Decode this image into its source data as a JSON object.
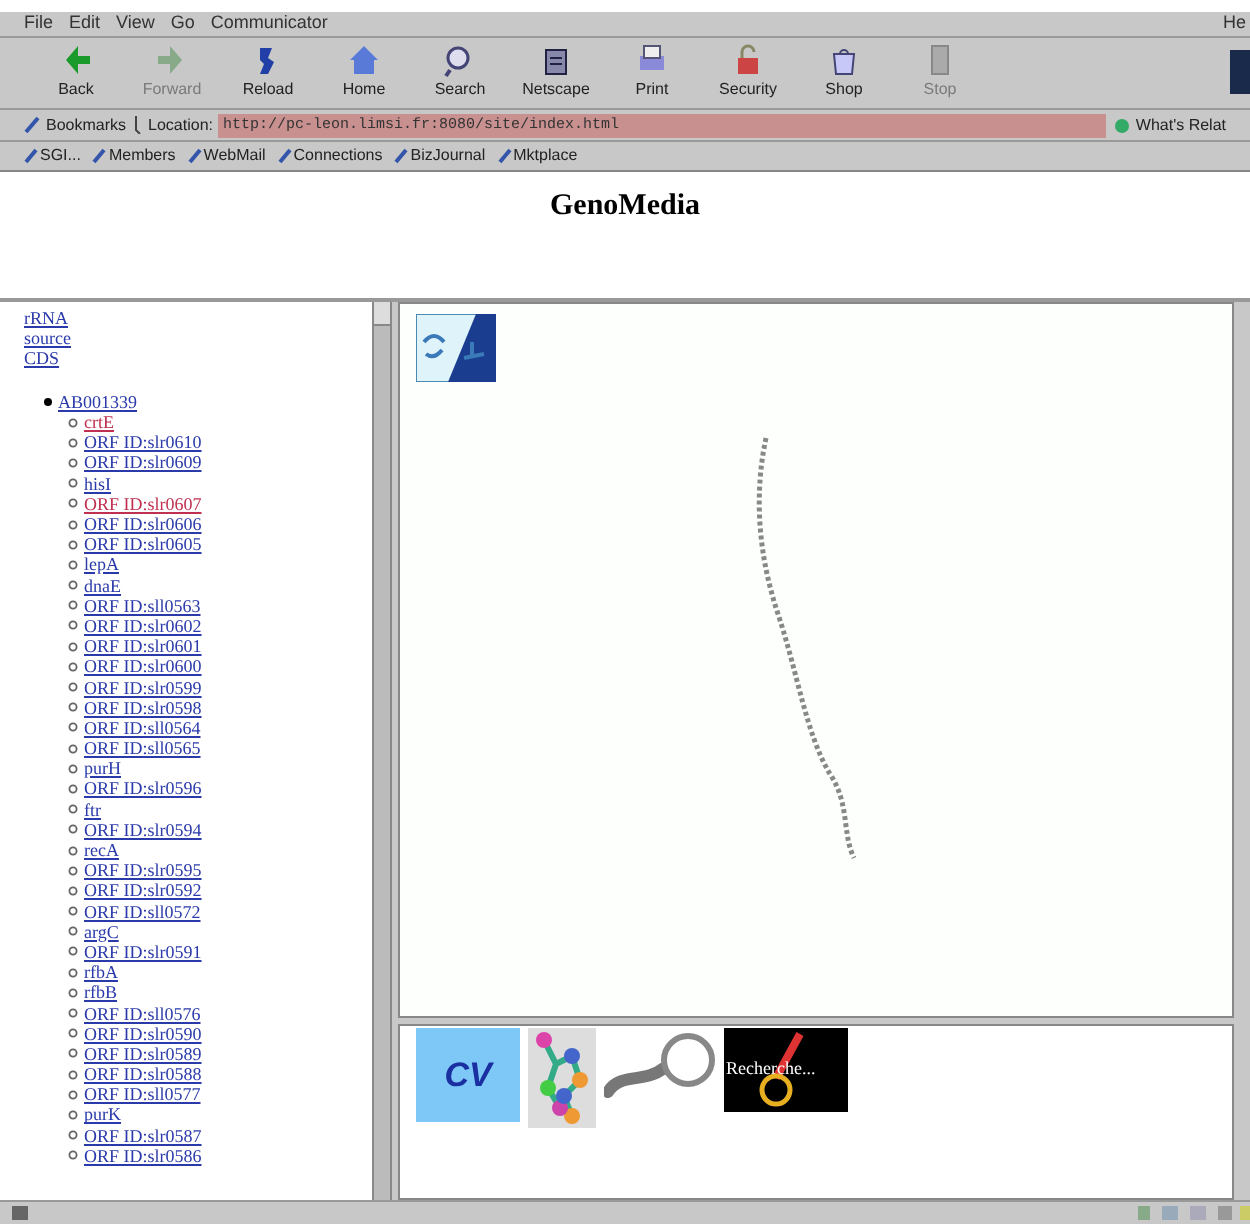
{
  "menu": [
    "File",
    "Edit",
    "View",
    "Go",
    "Communicator"
  ],
  "help_menu": "He",
  "toolbar": [
    {
      "label": "Back",
      "kind": "back",
      "disabled": false
    },
    {
      "label": "Forward",
      "kind": "forward",
      "disabled": true
    },
    {
      "label": "Reload",
      "kind": "reload",
      "disabled": false
    },
    {
      "label": "Home",
      "kind": "home",
      "disabled": false
    },
    {
      "label": "Search",
      "kind": "search",
      "disabled": false
    },
    {
      "label": "Netscape",
      "kind": "netscape",
      "disabled": false
    },
    {
      "label": "Print",
      "kind": "print",
      "disabled": false
    },
    {
      "label": "Security",
      "kind": "security",
      "disabled": false
    },
    {
      "label": "Shop",
      "kind": "shop",
      "disabled": false
    },
    {
      "label": "Stop",
      "kind": "stop",
      "disabled": true
    }
  ],
  "location_bar": {
    "bookmarks": "Bookmarks",
    "label": "Location:",
    "url": "http://pc-leon.limsi.fr:8080/site/index.html",
    "related": "What's Relat"
  },
  "personal_toolbar": [
    "SGI...",
    "Members",
    "WebMail",
    "Connections",
    "BizJournal",
    "Mktplace"
  ],
  "header": {
    "title": "GenoMedia"
  },
  "sidebar": {
    "links": [
      "rRNA",
      "source",
      "CDS"
    ],
    "tree": [
      {
        "label": "AB001339",
        "children": [
          {
            "label": "crtE",
            "visited": true
          },
          {
            "label": "ORF ID:slr0610",
            "visited": false
          },
          {
            "label": "ORF ID:slr0609",
            "visited": false
          },
          {
            "label": "hisI",
            "visited": false
          },
          {
            "label": "ORF ID:slr0607",
            "visited": true
          },
          {
            "label": "ORF ID:slr0606",
            "visited": false
          },
          {
            "label": "ORF ID:slr0605",
            "visited": false
          },
          {
            "label": "lepA",
            "visited": false
          },
          {
            "label": "dnaE",
            "visited": false
          },
          {
            "label": "ORF ID:sll0563",
            "visited": false
          },
          {
            "label": "ORF ID:slr0602",
            "visited": false
          },
          {
            "label": "ORF ID:slr0601",
            "visited": false
          },
          {
            "label": "ORF ID:slr0600",
            "visited": false
          },
          {
            "label": "ORF ID:slr0599",
            "visited": false
          },
          {
            "label": "ORF ID:slr0598",
            "visited": false
          },
          {
            "label": "ORF ID:sll0564",
            "visited": false
          },
          {
            "label": "ORF ID:sll0565",
            "visited": false
          },
          {
            "label": "purH",
            "visited": false
          },
          {
            "label": "ORF ID:slr0596",
            "visited": false
          },
          {
            "label": "ftr",
            "visited": false
          },
          {
            "label": "ORF ID:slr0594",
            "visited": false
          },
          {
            "label": "recA",
            "visited": false
          },
          {
            "label": "ORF ID:slr0595",
            "visited": false
          },
          {
            "label": "ORF ID:slr0592",
            "visited": false
          },
          {
            "label": "ORF ID:sll0572",
            "visited": false
          },
          {
            "label": "argC",
            "visited": false
          },
          {
            "label": "ORF ID:slr0591",
            "visited": false
          },
          {
            "label": "rfbA",
            "visited": false
          },
          {
            "label": "rfbB",
            "visited": false
          },
          {
            "label": "ORF ID:sll0576",
            "visited": false
          },
          {
            "label": "ORF ID:slr0590",
            "visited": false
          },
          {
            "label": "ORF ID:slr0589",
            "visited": false
          },
          {
            "label": "ORF ID:slr0588",
            "visited": false
          },
          {
            "label": "ORF ID:sll0577",
            "visited": false
          },
          {
            "label": "purK",
            "visited": false
          },
          {
            "label": "ORF ID:slr0587",
            "visited": false
          },
          {
            "label": "ORF ID:slr0586",
            "visited": false
          }
        ]
      }
    ]
  },
  "bottom_frame": {
    "cv": "CV",
    "search_image_text": "Recherche..."
  }
}
